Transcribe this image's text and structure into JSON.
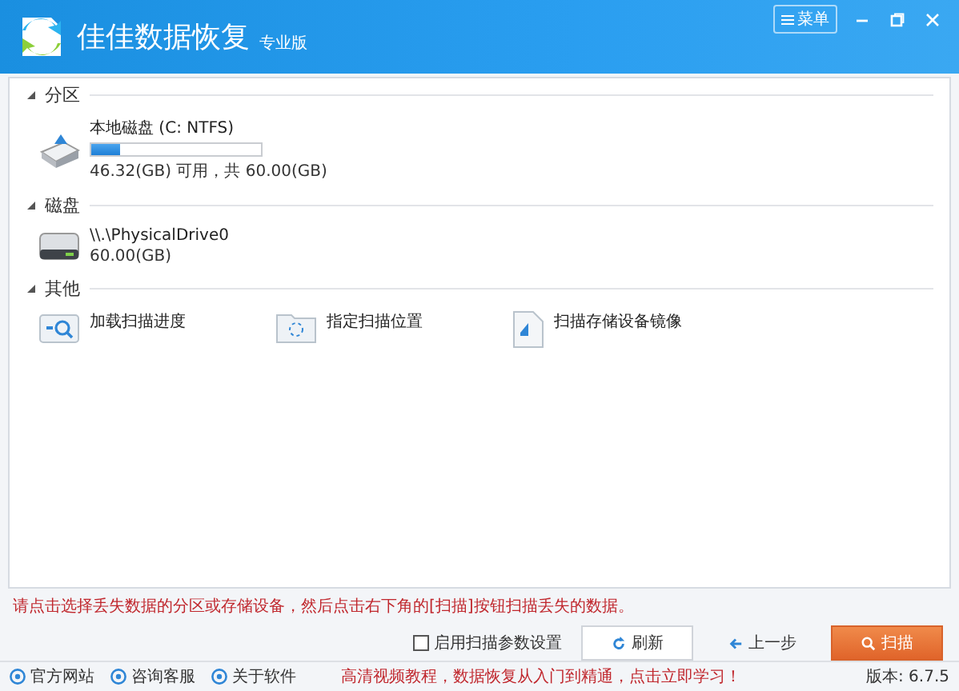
{
  "window": {
    "title": "佳佳数据恢复",
    "edition": "专业版",
    "menu_button": "菜单"
  },
  "sections": [
    {
      "title": "分区",
      "expanded": true,
      "items": [
        {
          "kind": "partition",
          "name": "本地磁盘 (C: NTFS)",
          "level": 0.17,
          "detail": "46.32(GB) 可用，共 60.00(GB)"
        }
      ]
    },
    {
      "title": "磁盘",
      "expanded": true,
      "items": [
        {
          "kind": "disk",
          "name": "\\\\.\\PhysicalDrive0",
          "detail": "60.00(GB)"
        }
      ]
    },
    {
      "title": "其他",
      "expanded": true,
      "items": [
        {
          "kind": "load",
          "name": "加载扫描进度"
        },
        {
          "kind": "location",
          "name": "指定扫描位置"
        },
        {
          "kind": "image",
          "name": "扫描存储设备镜像"
        }
      ]
    }
  ],
  "hint": "请点击选择丢失数据的分区或存储设备，然后点击右下角的[扫描]按钮扫描丢失的数据。",
  "scan_settings": {
    "label": "启用扫描参数设置",
    "checked": false
  },
  "buttons": [
    {
      "kind": "refresh",
      "label": "刷新"
    },
    {
      "kind": "back",
      "label": "上一步"
    },
    {
      "kind": "scan",
      "label": "扫描"
    }
  ],
  "footer_links": [
    "官方网站",
    "咨询客服",
    "关于软件"
  ],
  "promo": "高清视频教程，数据恢复从入门到精通，点击立即学习！",
  "version": "版本: 6.7.5"
}
